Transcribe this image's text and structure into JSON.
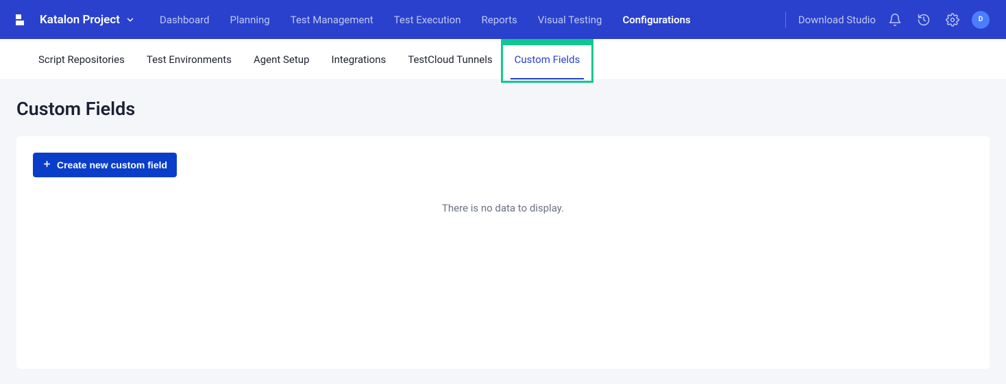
{
  "header": {
    "project_name": "Katalon Project",
    "nav": [
      "Dashboard",
      "Planning",
      "Test Management",
      "Test Execution",
      "Reports",
      "Visual Testing",
      "Configurations"
    ],
    "active_nav": "Configurations",
    "download_label": "Download Studio",
    "avatar_initial": "D"
  },
  "subnav": {
    "items": [
      "Script Repositories",
      "Test Environments",
      "Agent Setup",
      "Integrations",
      "TestCloud Tunnels",
      "Custom Fields"
    ],
    "active": "Custom Fields",
    "highlighted": "Custom Fields"
  },
  "page": {
    "title": "Custom Fields",
    "create_button": "Create new custom field",
    "empty_state": "There is no data to display."
  }
}
